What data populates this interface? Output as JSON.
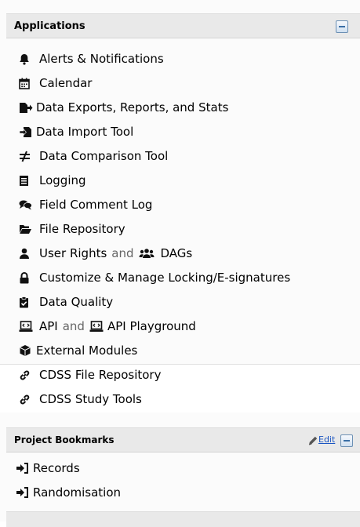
{
  "applications": {
    "title": "Applications",
    "items": [
      {
        "label": "Alerts & Notifications",
        "icon": "bell-icon"
      },
      {
        "label": "Calendar",
        "icon": "calendar-icon"
      },
      {
        "label": "Data Exports, Reports, and Stats",
        "icon": "file-export-icon"
      },
      {
        "label": "Data Import Tool",
        "icon": "file-import-icon"
      },
      {
        "label": "Data Comparison Tool",
        "icon": "not-equal-icon"
      },
      {
        "label": "Logging",
        "icon": "list-icon"
      },
      {
        "label": "Field Comment Log",
        "icon": "comments-icon"
      },
      {
        "label": "File Repository",
        "icon": "folder-open-icon"
      },
      {
        "label": "User Rights",
        "and": "and",
        "label2": "DAGs",
        "icon": "user-icon",
        "icon2": "users-icon"
      },
      {
        "label": "Customize & Manage Locking/E-signatures",
        "icon": "lock-icon"
      },
      {
        "label": "Data Quality",
        "icon": "clipboard-check-icon"
      },
      {
        "label": "API",
        "and": "and",
        "label2": "API Playground",
        "icon": "laptop-code-icon",
        "icon2": "laptop-code-icon"
      },
      {
        "label": "External Modules",
        "icon": "cube-icon"
      }
    ],
    "custom_links": [
      {
        "label": "CDSS File Repository",
        "icon": "link-icon"
      },
      {
        "label": "CDSS Study Tools",
        "icon": "link-icon"
      }
    ]
  },
  "bookmarks": {
    "title": "Project Bookmarks",
    "edit_label": "Edit",
    "items": [
      {
        "label": "Records",
        "icon": "sign-in-icon"
      },
      {
        "label": "Randomisation",
        "icon": "sign-in-icon"
      }
    ]
  },
  "colors": {
    "header_bg": "#e9e9e9",
    "link_blue": "#1a55c2"
  }
}
